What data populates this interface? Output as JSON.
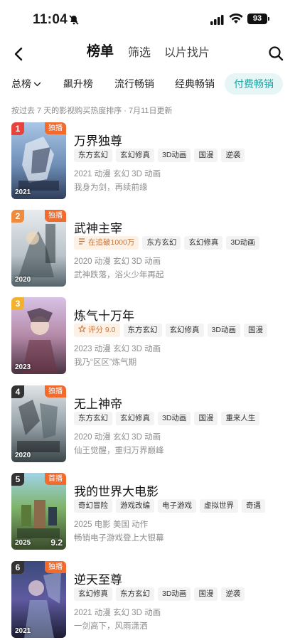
{
  "status_bar": {
    "time": "11:04",
    "battery": "93"
  },
  "nav": {
    "tabs": [
      "榜单",
      "筛选",
      "以片找片"
    ],
    "active_tab": 0
  },
  "subtabs": [
    "总榜",
    "飙升榜",
    "流行畅销",
    "经典畅销",
    "付费畅销"
  ],
  "active_subtab": 4,
  "hint": "按过去 7 天的影视购买热度排序 · 7月11日更新",
  "colors": {
    "accent": "#1aa5a3",
    "accent_bg": "#e6f6f6",
    "badge": "#f26a2c",
    "rank_gold": "#f3b22b",
    "rank_red": "#e8433b",
    "rank_orange": "#f08a3c",
    "rank_dark": "#333333"
  },
  "items": [
    {
      "rank": "1",
      "rank_color": "#e8433b",
      "badge": "独播",
      "poster_year": "2021",
      "poster_score": "",
      "title": "万界独尊",
      "special_tag": "",
      "tags": [
        "东方玄幻",
        "玄幻修真",
        "3D动画",
        "国漫",
        "逆袭"
      ],
      "meta": "2021 动漫 玄幻 3D 动画",
      "desc": "我身为剑，再续前缘"
    },
    {
      "rank": "2",
      "rank_color": "#f08a3c",
      "badge": "独播",
      "poster_year": "2020",
      "poster_score": "",
      "title": "武神主宰",
      "special_tag": "在追破1000万",
      "special_icon": "list-icon",
      "tags": [
        "东方玄幻",
        "玄幻修真",
        "3D动画"
      ],
      "meta": "2020 动漫 玄幻 3D 动画",
      "desc": "武神跌落，浴火少年再起"
    },
    {
      "rank": "3",
      "rank_color": "#f3b22b",
      "badge": "",
      "poster_year": "2023",
      "poster_score": "",
      "title": "炼气十万年",
      "special_tag": "评分 9.0",
      "special_icon": "star-icon",
      "tags": [
        "东方玄幻",
        "玄幻修真",
        "3D动画",
        "国漫"
      ],
      "meta": "2023 动漫 玄幻 3D 动画",
      "desc": "我乃“区区”炼气期"
    },
    {
      "rank": "4",
      "rank_color": "#333333",
      "badge": "独播",
      "poster_year": "2020",
      "poster_score": "",
      "title": "无上神帝",
      "special_tag": "",
      "tags": [
        "东方玄幻",
        "玄幻修真",
        "3D动画",
        "国漫",
        "重来人生"
      ],
      "meta": "2020 动漫 玄幻 3D 动画",
      "desc": "仙王觉醒，重归万界巅峰"
    },
    {
      "rank": "5",
      "rank_color": "#333333",
      "badge": "首播",
      "poster_year": "2025",
      "poster_score": "9.2",
      "title": "我的世界大电影",
      "special_tag": "",
      "tags": [
        "奇幻冒险",
        "游戏改编",
        "电子游戏",
        "虚拟世界",
        "奇遇"
      ],
      "meta": "2025 电影 美国 动作",
      "desc": "畅销电子游戏登上大银幕"
    },
    {
      "rank": "6",
      "rank_color": "#333333",
      "badge": "独播",
      "poster_year": "2021",
      "poster_score": "",
      "title": "逆天至尊",
      "special_tag": "",
      "tags": [
        "玄幻修真",
        "东方玄幻",
        "3D动画",
        "国漫",
        "逆袭"
      ],
      "meta": "2021 动漫 玄幻 3D 动画",
      "desc": "一剑高下，风雨潇洒"
    }
  ]
}
